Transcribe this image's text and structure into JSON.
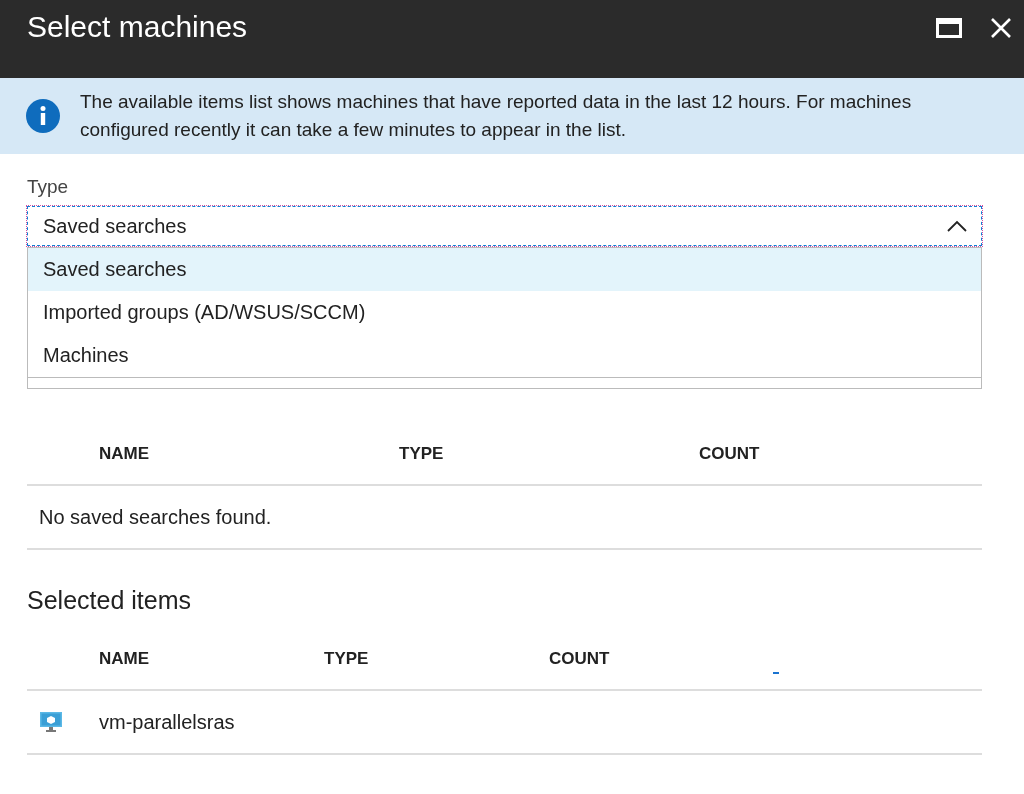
{
  "window": {
    "title": "Select machines"
  },
  "info_banner": {
    "text": "The available items list shows machines that have reported data in the last 12 hours. For machines configured recently it can take a few minutes to appear in the list."
  },
  "type_field": {
    "label": "Type",
    "value": "Saved searches",
    "expanded": true,
    "options": [
      {
        "label": "Saved searches",
        "selected": true
      },
      {
        "label": "Imported groups (AD/WSUS/SCCM)",
        "selected": false
      },
      {
        "label": "Machines",
        "selected": false
      }
    ]
  },
  "available_table": {
    "columns": [
      "NAME",
      "TYPE",
      "COUNT"
    ],
    "empty_message": "No saved searches found."
  },
  "selected_items": {
    "title": "Selected items",
    "columns": [
      "NAME",
      "TYPE",
      "COUNT"
    ],
    "rows": [
      {
        "name": "vm-parallelsras"
      }
    ]
  }
}
